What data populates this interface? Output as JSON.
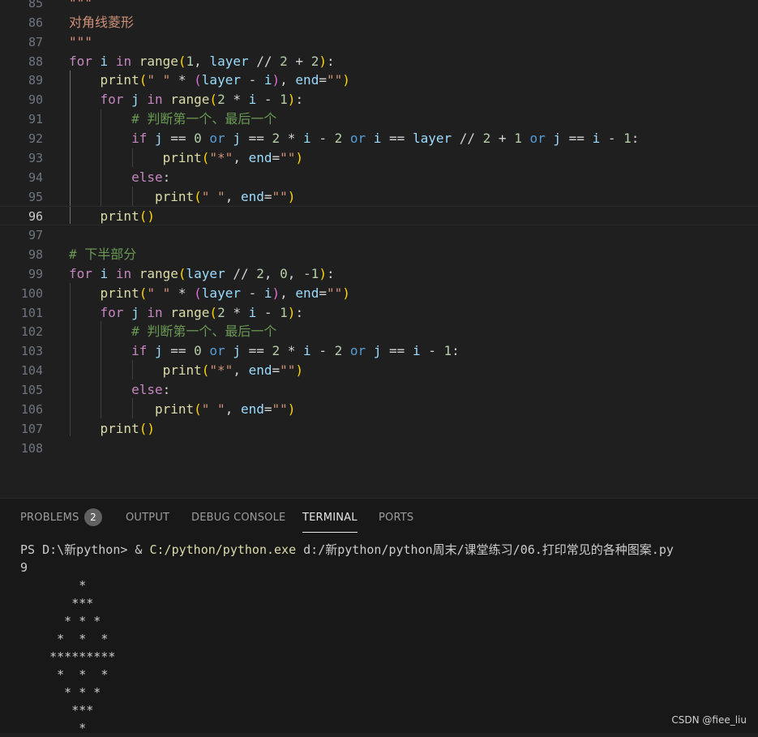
{
  "editor": {
    "lines": [
      {
        "n": "85",
        "tokens": [
          {
            "t": "\"\"\"",
            "c": "str"
          }
        ]
      },
      {
        "n": "86",
        "tokens": [
          {
            "t": "对角线菱形",
            "c": "str"
          }
        ]
      },
      {
        "n": "87",
        "tokens": [
          {
            "t": "\"\"\"",
            "c": "str"
          }
        ]
      },
      {
        "n": "88",
        "tokens": [
          {
            "t": "for",
            "c": "kw"
          },
          {
            "t": " i ",
            "c": "var"
          },
          {
            "t": "in",
            "c": "kw"
          },
          {
            "t": " ",
            "c": "op"
          },
          {
            "t": "range",
            "c": "fn"
          },
          {
            "t": "(",
            "c": "p1"
          },
          {
            "t": "1",
            "c": "num"
          },
          {
            "t": ", ",
            "c": "op"
          },
          {
            "t": "layer",
            "c": "var"
          },
          {
            "t": " // ",
            "c": "op"
          },
          {
            "t": "2",
            "c": "num"
          },
          {
            "t": " + ",
            "c": "op"
          },
          {
            "t": "2",
            "c": "num"
          },
          {
            "t": ")",
            "c": "p1"
          },
          {
            "t": ":",
            "c": "op"
          }
        ]
      },
      {
        "n": "89",
        "tokens": [
          {
            "t": "    ",
            "c": "op"
          },
          {
            "t": "print",
            "c": "fn"
          },
          {
            "t": "(",
            "c": "p1"
          },
          {
            "t": "\" \"",
            "c": "str"
          },
          {
            "t": " * ",
            "c": "op"
          },
          {
            "t": "(",
            "c": "p2"
          },
          {
            "t": "layer",
            "c": "var"
          },
          {
            "t": " - ",
            "c": "op"
          },
          {
            "t": "i",
            "c": "var"
          },
          {
            "t": ")",
            "c": "p2"
          },
          {
            "t": ", ",
            "c": "op"
          },
          {
            "t": "end",
            "c": "var"
          },
          {
            "t": "=",
            "c": "op"
          },
          {
            "t": "\"\"",
            "c": "str"
          },
          {
            "t": ")",
            "c": "p1"
          }
        ]
      },
      {
        "n": "90",
        "tokens": [
          {
            "t": "    ",
            "c": "op"
          },
          {
            "t": "for",
            "c": "kw"
          },
          {
            "t": " j ",
            "c": "var"
          },
          {
            "t": "in",
            "c": "kw"
          },
          {
            "t": " ",
            "c": "op"
          },
          {
            "t": "range",
            "c": "fn"
          },
          {
            "t": "(",
            "c": "p1"
          },
          {
            "t": "2",
            "c": "num"
          },
          {
            "t": " * ",
            "c": "op"
          },
          {
            "t": "i",
            "c": "var"
          },
          {
            "t": " - ",
            "c": "op"
          },
          {
            "t": "1",
            "c": "num"
          },
          {
            "t": ")",
            "c": "p1"
          },
          {
            "t": ":",
            "c": "op"
          }
        ]
      },
      {
        "n": "91",
        "tokens": [
          {
            "t": "        ",
            "c": "op"
          },
          {
            "t": "# 判断第一个、最后一个",
            "c": "cmt"
          }
        ]
      },
      {
        "n": "92",
        "tokens": [
          {
            "t": "        ",
            "c": "op"
          },
          {
            "t": "if",
            "c": "kw"
          },
          {
            "t": " j ",
            "c": "var"
          },
          {
            "t": "== ",
            "c": "op"
          },
          {
            "t": "0",
            "c": "num"
          },
          {
            "t": " ",
            "c": "op"
          },
          {
            "t": "or",
            "c": "kw2"
          },
          {
            "t": " j ",
            "c": "var"
          },
          {
            "t": "== ",
            "c": "op"
          },
          {
            "t": "2",
            "c": "num"
          },
          {
            "t": " * ",
            "c": "op"
          },
          {
            "t": "i",
            "c": "var"
          },
          {
            "t": " - ",
            "c": "op"
          },
          {
            "t": "2",
            "c": "num"
          },
          {
            "t": " ",
            "c": "op"
          },
          {
            "t": "or",
            "c": "kw2"
          },
          {
            "t": " i ",
            "c": "var"
          },
          {
            "t": "== ",
            "c": "op"
          },
          {
            "t": "layer",
            "c": "var"
          },
          {
            "t": " // ",
            "c": "op"
          },
          {
            "t": "2",
            "c": "num"
          },
          {
            "t": " + ",
            "c": "op"
          },
          {
            "t": "1",
            "c": "num"
          },
          {
            "t": " ",
            "c": "op"
          },
          {
            "t": "or",
            "c": "kw2"
          },
          {
            "t": " j ",
            "c": "var"
          },
          {
            "t": "== ",
            "c": "op"
          },
          {
            "t": "i",
            "c": "var"
          },
          {
            "t": " - ",
            "c": "op"
          },
          {
            "t": "1",
            "c": "num"
          },
          {
            "t": ":",
            "c": "op"
          }
        ]
      },
      {
        "n": "93",
        "tokens": [
          {
            "t": "            ",
            "c": "op"
          },
          {
            "t": "print",
            "c": "fn"
          },
          {
            "t": "(",
            "c": "p1"
          },
          {
            "t": "\"*\"",
            "c": "str"
          },
          {
            "t": ", ",
            "c": "op"
          },
          {
            "t": "end",
            "c": "var"
          },
          {
            "t": "=",
            "c": "op"
          },
          {
            "t": "\"\"",
            "c": "str"
          },
          {
            "t": ")",
            "c": "p1"
          }
        ]
      },
      {
        "n": "94",
        "tokens": [
          {
            "t": "        ",
            "c": "op"
          },
          {
            "t": "else",
            "c": "kw"
          },
          {
            "t": ":",
            "c": "op"
          }
        ]
      },
      {
        "n": "95",
        "tokens": [
          {
            "t": "           ",
            "c": "op"
          },
          {
            "t": "print",
            "c": "fn"
          },
          {
            "t": "(",
            "c": "p1"
          },
          {
            "t": "\" \"",
            "c": "str"
          },
          {
            "t": ", ",
            "c": "op"
          },
          {
            "t": "end",
            "c": "var"
          },
          {
            "t": "=",
            "c": "op"
          },
          {
            "t": "\"\"",
            "c": "str"
          },
          {
            "t": ")",
            "c": "p1"
          }
        ]
      },
      {
        "n": "96",
        "tokens": [
          {
            "t": "    ",
            "c": "op"
          },
          {
            "t": "print",
            "c": "fn"
          },
          {
            "t": "()",
            "c": "p1"
          }
        ]
      },
      {
        "n": "97",
        "tokens": []
      },
      {
        "n": "98",
        "tokens": [
          {
            "t": "# 下半部分",
            "c": "cmt"
          }
        ]
      },
      {
        "n": "99",
        "tokens": [
          {
            "t": "for",
            "c": "kw"
          },
          {
            "t": " i ",
            "c": "var"
          },
          {
            "t": "in",
            "c": "kw"
          },
          {
            "t": " ",
            "c": "op"
          },
          {
            "t": "range",
            "c": "fn"
          },
          {
            "t": "(",
            "c": "p1"
          },
          {
            "t": "layer",
            "c": "var"
          },
          {
            "t": " // ",
            "c": "op"
          },
          {
            "t": "2",
            "c": "num"
          },
          {
            "t": ", ",
            "c": "op"
          },
          {
            "t": "0",
            "c": "num"
          },
          {
            "t": ", ",
            "c": "op"
          },
          {
            "t": "-1",
            "c": "num"
          },
          {
            "t": ")",
            "c": "p1"
          },
          {
            "t": ":",
            "c": "op"
          }
        ]
      },
      {
        "n": "100",
        "tokens": [
          {
            "t": "    ",
            "c": "op"
          },
          {
            "t": "print",
            "c": "fn"
          },
          {
            "t": "(",
            "c": "p1"
          },
          {
            "t": "\" \"",
            "c": "str"
          },
          {
            "t": " * ",
            "c": "op"
          },
          {
            "t": "(",
            "c": "p2"
          },
          {
            "t": "layer",
            "c": "var"
          },
          {
            "t": " - ",
            "c": "op"
          },
          {
            "t": "i",
            "c": "var"
          },
          {
            "t": ")",
            "c": "p2"
          },
          {
            "t": ", ",
            "c": "op"
          },
          {
            "t": "end",
            "c": "var"
          },
          {
            "t": "=",
            "c": "op"
          },
          {
            "t": "\"\"",
            "c": "str"
          },
          {
            "t": ")",
            "c": "p1"
          }
        ]
      },
      {
        "n": "101",
        "tokens": [
          {
            "t": "    ",
            "c": "op"
          },
          {
            "t": "for",
            "c": "kw"
          },
          {
            "t": " j ",
            "c": "var"
          },
          {
            "t": "in",
            "c": "kw"
          },
          {
            "t": " ",
            "c": "op"
          },
          {
            "t": "range",
            "c": "fn"
          },
          {
            "t": "(",
            "c": "p1"
          },
          {
            "t": "2",
            "c": "num"
          },
          {
            "t": " * ",
            "c": "op"
          },
          {
            "t": "i",
            "c": "var"
          },
          {
            "t": " - ",
            "c": "op"
          },
          {
            "t": "1",
            "c": "num"
          },
          {
            "t": ")",
            "c": "p1"
          },
          {
            "t": ":",
            "c": "op"
          }
        ]
      },
      {
        "n": "102",
        "tokens": [
          {
            "t": "        ",
            "c": "op"
          },
          {
            "t": "# 判断第一个、最后一个",
            "c": "cmt"
          }
        ]
      },
      {
        "n": "103",
        "tokens": [
          {
            "t": "        ",
            "c": "op"
          },
          {
            "t": "if",
            "c": "kw"
          },
          {
            "t": " j ",
            "c": "var"
          },
          {
            "t": "== ",
            "c": "op"
          },
          {
            "t": "0",
            "c": "num"
          },
          {
            "t": " ",
            "c": "op"
          },
          {
            "t": "or",
            "c": "kw2"
          },
          {
            "t": " j ",
            "c": "var"
          },
          {
            "t": "== ",
            "c": "op"
          },
          {
            "t": "2",
            "c": "num"
          },
          {
            "t": " * ",
            "c": "op"
          },
          {
            "t": "i",
            "c": "var"
          },
          {
            "t": " - ",
            "c": "op"
          },
          {
            "t": "2",
            "c": "num"
          },
          {
            "t": " ",
            "c": "op"
          },
          {
            "t": "or",
            "c": "kw2"
          },
          {
            "t": " j ",
            "c": "var"
          },
          {
            "t": "== ",
            "c": "op"
          },
          {
            "t": "i",
            "c": "var"
          },
          {
            "t": " - ",
            "c": "op"
          },
          {
            "t": "1",
            "c": "num"
          },
          {
            "t": ":",
            "c": "op"
          }
        ]
      },
      {
        "n": "104",
        "tokens": [
          {
            "t": "            ",
            "c": "op"
          },
          {
            "t": "print",
            "c": "fn"
          },
          {
            "t": "(",
            "c": "p1"
          },
          {
            "t": "\"*\"",
            "c": "str"
          },
          {
            "t": ", ",
            "c": "op"
          },
          {
            "t": "end",
            "c": "var"
          },
          {
            "t": "=",
            "c": "op"
          },
          {
            "t": "\"\"",
            "c": "str"
          },
          {
            "t": ")",
            "c": "p1"
          }
        ]
      },
      {
        "n": "105",
        "tokens": [
          {
            "t": "        ",
            "c": "op"
          },
          {
            "t": "else",
            "c": "kw"
          },
          {
            "t": ":",
            "c": "op"
          }
        ]
      },
      {
        "n": "106",
        "tokens": [
          {
            "t": "           ",
            "c": "op"
          },
          {
            "t": "print",
            "c": "fn"
          },
          {
            "t": "(",
            "c": "p1"
          },
          {
            "t": "\" \"",
            "c": "str"
          },
          {
            "t": ", ",
            "c": "op"
          },
          {
            "t": "end",
            "c": "var"
          },
          {
            "t": "=",
            "c": "op"
          },
          {
            "t": "\"\"",
            "c": "str"
          },
          {
            "t": ")",
            "c": "p1"
          }
        ]
      },
      {
        "n": "107",
        "tokens": [
          {
            "t": "    ",
            "c": "op"
          },
          {
            "t": "print",
            "c": "fn"
          },
          {
            "t": "()",
            "c": "p1"
          }
        ]
      },
      {
        "n": "108",
        "tokens": []
      }
    ],
    "active_line": "96"
  },
  "panel": {
    "tabs": [
      {
        "id": "problems",
        "label": "PROBLEMS",
        "active": false
      },
      {
        "id": "output",
        "label": "OUTPUT",
        "active": false
      },
      {
        "id": "debug",
        "label": "DEBUG CONSOLE",
        "active": false
      },
      {
        "id": "terminal",
        "label": "TERMINAL",
        "active": true
      },
      {
        "id": "ports",
        "label": "PORTS",
        "active": false
      }
    ],
    "problems_count": "2"
  },
  "terminal": {
    "prompt": "PS D:\\新python> & ",
    "exe": "C:/python/python.exe",
    "script": " d:/新python/python周末/课堂练习/06.打印常见的各种图案.py",
    "output": [
      "9",
      "        *",
      "       ***",
      "      * * *",
      "     *  *  *",
      "    *********",
      "     *  *  *",
      "      * * *",
      "       ***",
      "        *"
    ]
  },
  "watermark": "CSDN @fiee_liu",
  "colors": {
    "editor_bg": "#1f1f1f",
    "panel_bg": "#181818",
    "keyword": "#c586c0",
    "function": "#dcdcaa",
    "variable": "#9cdcfe",
    "number": "#b5cea8",
    "string": "#ce9178",
    "comment": "#6a9955"
  }
}
